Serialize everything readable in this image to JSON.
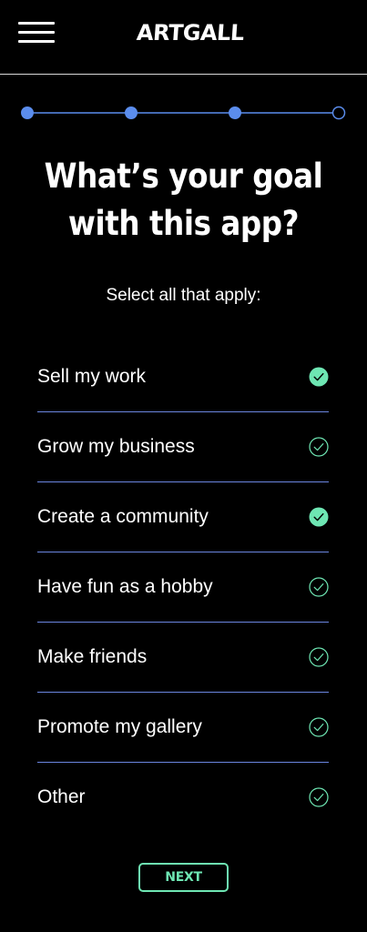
{
  "header": {
    "logo": "ARTGALL",
    "menu_icon": "hamburger-menu-icon"
  },
  "progress": {
    "total_steps": 4,
    "completed_steps": 3,
    "active_color": "#5b8ded",
    "line_color": "#5b8ded"
  },
  "title": {
    "line1": "What’s your goal",
    "line2": "with this app?"
  },
  "subtitle": "Select all that apply:",
  "options": [
    {
      "label": "Sell my work",
      "checked": true
    },
    {
      "label": "Grow my business",
      "checked": false
    },
    {
      "label": "Create a community",
      "checked": true
    },
    {
      "label": "Have fun as a hobby",
      "checked": false
    },
    {
      "label": "Make friends",
      "checked": false
    },
    {
      "label": "Promote my gallery",
      "checked": false
    },
    {
      "label": "Other",
      "checked": false
    }
  ],
  "next_button": {
    "label": "NEXT"
  },
  "colors": {
    "background": "#000000",
    "accent_green": "#6ee6b3",
    "divider_blue": "#6b86e0",
    "progress_blue": "#5b8ded"
  }
}
